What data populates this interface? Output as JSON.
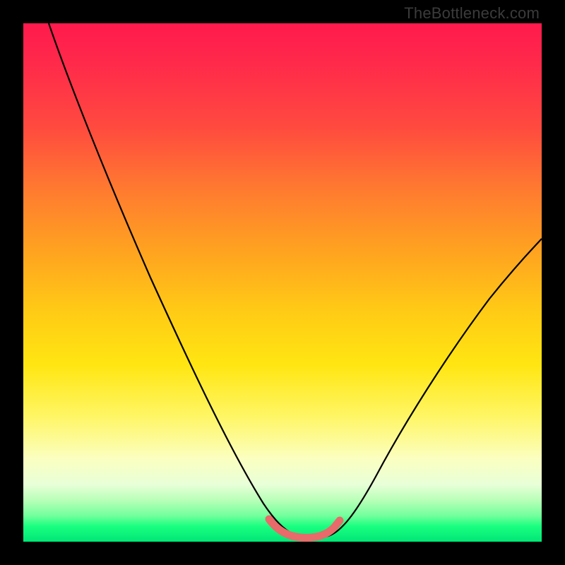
{
  "watermark": "TheBottleneck.com",
  "chart_data": {
    "type": "line",
    "title": "",
    "xlabel": "",
    "ylabel": "",
    "xlim": [
      0,
      100
    ],
    "ylim": [
      0,
      100
    ],
    "background_gradient": {
      "direction": "vertical",
      "stops": [
        {
          "pos": 0,
          "color": "#ff1a4d"
        },
        {
          "pos": 20,
          "color": "#ff4a3f"
        },
        {
          "pos": 44,
          "color": "#ffa320"
        },
        {
          "pos": 66,
          "color": "#ffe612"
        },
        {
          "pos": 84,
          "color": "#fbffc0"
        },
        {
          "pos": 95,
          "color": "#72ff9c"
        },
        {
          "pos": 100,
          "color": "#00e676"
        }
      ]
    },
    "series": [
      {
        "name": "thin-black-curve",
        "stroke": "#000000",
        "stroke_width": 2,
        "x": [
          5,
          10,
          15,
          20,
          25,
          30,
          35,
          40,
          45,
          48,
          50,
          53,
          56,
          58,
          60,
          65,
          70,
          75,
          80,
          85,
          90,
          95,
          100
        ],
        "y": [
          100,
          90,
          80,
          70,
          59,
          48,
          37,
          26,
          14,
          7,
          4,
          2,
          1,
          1,
          2,
          6,
          12,
          20,
          28,
          36,
          44,
          51,
          58
        ]
      },
      {
        "name": "highlight-pink-segment",
        "stroke": "#e86a6a",
        "stroke_width": 10,
        "x": [
          48,
          50,
          53,
          56,
          58,
          60
        ],
        "y": [
          4,
          2,
          1,
          1,
          1.5,
          3
        ]
      }
    ]
  }
}
